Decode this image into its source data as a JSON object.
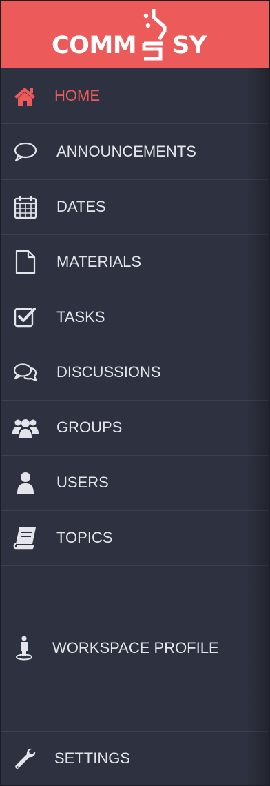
{
  "brand": {
    "logo_text": "COMM",
    "logo_suffix": "SY",
    "accent_color": "#ec5a5a",
    "background_color": "#2e3240",
    "text_color": "#e3e5ea"
  },
  "nav": {
    "items": [
      {
        "label": "HOME",
        "icon": "home-icon",
        "active": true
      },
      {
        "label": "ANNOUNCEMENTS",
        "icon": "speech-bubble-icon",
        "active": false
      },
      {
        "label": "DATES",
        "icon": "calendar-icon",
        "active": false
      },
      {
        "label": "MATERIALS",
        "icon": "document-icon",
        "active": false
      },
      {
        "label": "TASKS",
        "icon": "checkbox-icon",
        "active": false
      },
      {
        "label": "DISCUSSIONS",
        "icon": "discussions-icon",
        "active": false
      },
      {
        "label": "GROUPS",
        "icon": "group-icon",
        "active": false
      },
      {
        "label": "USERS",
        "icon": "user-icon",
        "active": false
      },
      {
        "label": "TOPICS",
        "icon": "book-icon",
        "active": false
      }
    ],
    "workspace_profile": {
      "label": "WORKSPACE PROFILE",
      "icon": "person-pin-icon"
    },
    "settings": {
      "label": "SETTINGS",
      "icon": "wrench-icon"
    }
  }
}
